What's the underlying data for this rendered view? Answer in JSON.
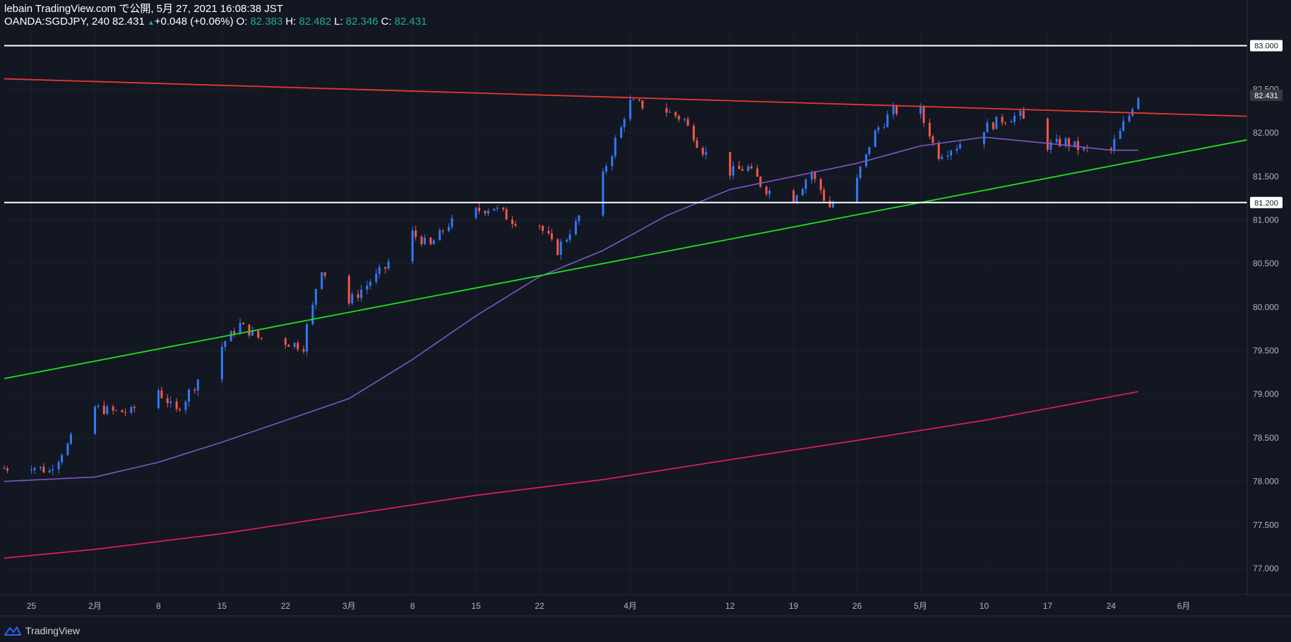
{
  "header": {
    "line1": "lebain TradingView.com で公開, 5月 27, 2021 16:08:38 JST",
    "symbol": "OANDA:SGDJPY, 240",
    "last": "82.431",
    "change_arrow": "▲",
    "change": "+0.048 (+0.06%)",
    "o_label": "O:",
    "o_value": "82.383",
    "h_label": "H:",
    "h_value": "82.482",
    "l_label": "L:",
    "l_value": "82.346",
    "c_label": "C:",
    "c_value": "82.431"
  },
  "footer": {
    "brand": "TradingView",
    "logo_icon": "tradingview-logo-icon"
  },
  "colors": {
    "background": "#131722",
    "up": "#3179f5",
    "down": "#f4574b",
    "resistance": "#e53935",
    "support": "#1fe01f",
    "ma_mid": "#7e57c2",
    "ma_long": "#e91e63",
    "level": "#ffffff",
    "grid": "#1b2030"
  },
  "chart_data": {
    "type": "line",
    "yticks": [
      "83.000",
      "82.500",
      "82.000",
      "81.500",
      "81.000",
      "80.500",
      "80.000",
      "79.500",
      "79.000",
      "78.500",
      "78.000",
      "77.500",
      "77.000"
    ],
    "ytick_values": [
      83.0,
      82.5,
      82.0,
      81.5,
      81.0,
      80.5,
      80.0,
      79.5,
      79.0,
      78.5,
      78.0,
      77.5,
      77.0
    ],
    "ylim": [
      76.7,
      83.2
    ],
    "x_dates": [
      "2021-01-22",
      "2021-01-25",
      "2021-01-27",
      "2021-02-01",
      "2021-02-03",
      "2021-02-05",
      "2021-02-08",
      "2021-02-10",
      "2021-02-12",
      "2021-02-15",
      "2021-02-17",
      "2021-02-19",
      "2021-02-22",
      "2021-02-24",
      "2021-02-26",
      "2021-03-01",
      "2021-03-03",
      "2021-03-05",
      "2021-03-08",
      "2021-03-10",
      "2021-03-12",
      "2021-03-15",
      "2021-03-17",
      "2021-03-19",
      "2021-03-22",
      "2021-03-24",
      "2021-03-26",
      "2021-03-29",
      "2021-03-31",
      "2021-04-01",
      "2021-04-05",
      "2021-04-07",
      "2021-04-09",
      "2021-04-12",
      "2021-04-14",
      "2021-04-16",
      "2021-04-19",
      "2021-04-21",
      "2021-04-23",
      "2021-04-26",
      "2021-04-28",
      "2021-04-30",
      "2021-05-03",
      "2021-05-05",
      "2021-05-07",
      "2021-05-10",
      "2021-05-12",
      "2021-05-14",
      "2021-05-17",
      "2021-05-19",
      "2021-05-21",
      "2021-05-24",
      "2021-05-26",
      "2021-05-27"
    ],
    "x_close": [
      78.15,
      78.18,
      78.12,
      78.85,
      78.8,
      78.8,
      79.05,
      78.8,
      79.1,
      79.55,
      79.8,
      79.65,
      79.6,
      79.55,
      80.45,
      80.05,
      80.25,
      80.45,
      80.85,
      80.7,
      80.95,
      81.1,
      81.15,
      81.0,
      80.95,
      80.65,
      80.95,
      81.5,
      82.05,
      82.35,
      82.25,
      82.15,
      81.8,
      81.55,
      81.6,
      81.35,
      81.25,
      81.55,
      81.15,
      81.45,
      82.0,
      82.25,
      82.25,
      81.75,
      81.85,
      82.05,
      82.15,
      82.2,
      81.85,
      81.9,
      81.8,
      81.8,
      82.2,
      82.43
    ],
    "xtick_labels": [
      "25",
      "2月",
      "8",
      "15",
      "22",
      "3月",
      "8",
      "15",
      "22",
      "4月",
      "12",
      "19",
      "26",
      "5月",
      "10",
      "17",
      "24",
      "6月"
    ],
    "xtick_dates": [
      "2021-01-25",
      "2021-02-01",
      "2021-02-08",
      "2021-02-15",
      "2021-02-22",
      "2021-03-01",
      "2021-03-08",
      "2021-03-15",
      "2021-03-22",
      "2021-04-01",
      "2021-04-12",
      "2021-04-19",
      "2021-04-26",
      "2021-05-03",
      "2021-05-10",
      "2021-05-17",
      "2021-05-24",
      "2021-06-01"
    ],
    "levels": [
      {
        "value": 83.0,
        "label": "83.000"
      },
      {
        "value": 81.2,
        "label": "81.200"
      }
    ],
    "last_price": {
      "value": 82.431,
      "label": "82.431"
    },
    "trendlines": [
      {
        "name": "resistance",
        "from": [
          "2021-01-22",
          82.62
        ],
        "to": [
          "2021-06-08",
          82.19
        ]
      },
      {
        "name": "support",
        "from": [
          "2021-01-22",
          79.18
        ],
        "to": [
          "2021-06-08",
          81.92
        ]
      }
    ],
    "ma_mid": {
      "x": [
        "2021-01-22",
        "2021-02-01",
        "2021-02-08",
        "2021-02-15",
        "2021-02-22",
        "2021-03-01",
        "2021-03-08",
        "2021-03-15",
        "2021-03-22",
        "2021-03-29",
        "2021-04-05",
        "2021-04-12",
        "2021-04-19",
        "2021-04-26",
        "2021-05-03",
        "2021-05-10",
        "2021-05-17",
        "2021-05-24",
        "2021-05-27"
      ],
      "y": [
        78.0,
        78.05,
        78.22,
        78.45,
        78.7,
        78.95,
        79.4,
        79.9,
        80.35,
        80.65,
        81.05,
        81.35,
        81.5,
        81.65,
        81.85,
        81.95,
        81.88,
        81.8,
        81.8
      ]
    },
    "ma_long": {
      "x": [
        "2021-01-22",
        "2021-02-01",
        "2021-02-15",
        "2021-03-01",
        "2021-03-15",
        "2021-03-29",
        "2021-04-12",
        "2021-04-26",
        "2021-05-10",
        "2021-05-27"
      ],
      "y": [
        77.12,
        77.22,
        77.4,
        77.62,
        77.84,
        78.02,
        78.25,
        78.47,
        78.7,
        79.03
      ]
    }
  }
}
